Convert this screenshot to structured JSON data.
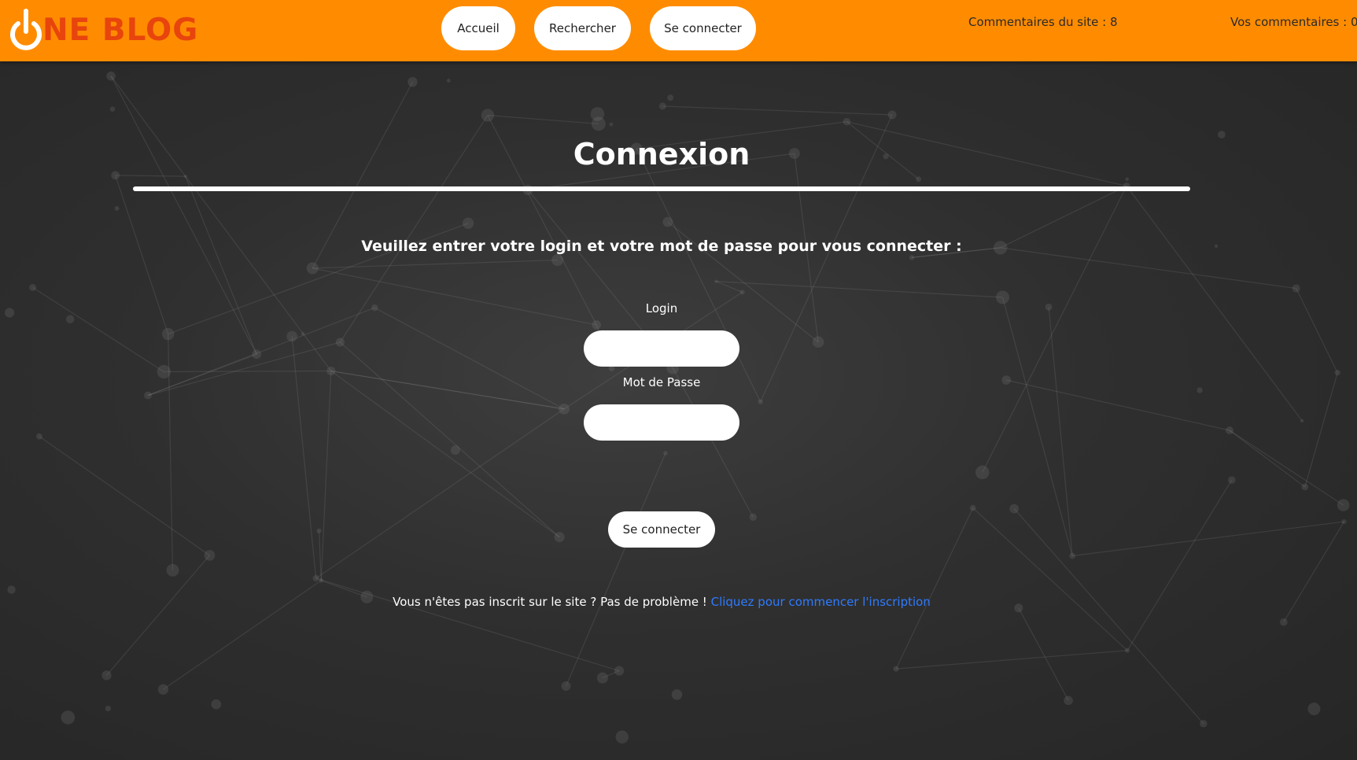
{
  "header": {
    "logo_text": "NE BLOG",
    "nav": [
      {
        "label": "Accueil"
      },
      {
        "label": "Rechercher"
      },
      {
        "label": "Se connecter"
      }
    ],
    "site_comments": "Commentaires du site : 8",
    "your_comments": "Vos commentaires : 0"
  },
  "login": {
    "title": "Connexion",
    "instructions": "Veuillez entrer votre login et votre mot de passe pour vous connecter :",
    "login_label": "Login",
    "login_value": "",
    "password_label": "Mot de Passe",
    "password_value": "",
    "submit_label": "Se connecter",
    "signup_text": "Vous n'êtes pas inscrit sur le site ? Pas de problème ! ",
    "signup_link": "Cliquez pour commencer l'inscription"
  },
  "colors": {
    "header_bg": "#ff8c00",
    "logo": "#e8440d",
    "link": "#2f7bff",
    "page_bg": "#2b2b2b"
  }
}
